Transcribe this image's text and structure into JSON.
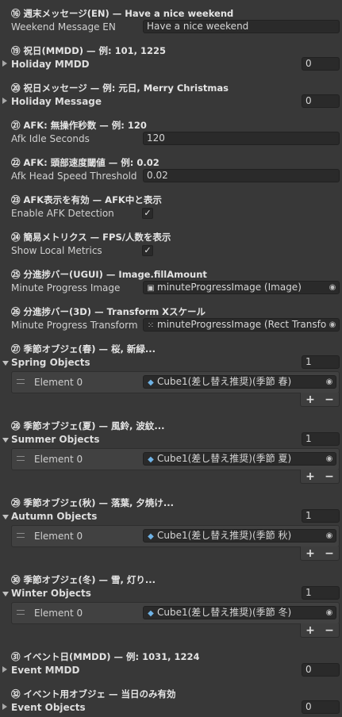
{
  "sections": {
    "s16": {
      "header": "⑯ 週末メッセージ(EN) — Have a nice weekend",
      "label": "Weekend Message EN",
      "value": "Have a nice weekend"
    },
    "s19": {
      "header": "⑲ 祝日(MMDD) — 例: 101, 1225",
      "label": "Holiday MMDD",
      "value": "0"
    },
    "s20": {
      "header": "⑳ 祝日メッセージ — 例: 元日, Merry Christmas",
      "label": "Holiday Message",
      "value": "0"
    },
    "s21": {
      "header": "㉑ AFK: 無操作秒数 — 例: 120",
      "label": "Afk Idle Seconds",
      "value": "120"
    },
    "s22": {
      "header": "㉒ AFK: 頭部速度閾値 — 例: 0.02",
      "label": "Afk Head Speed Threshold",
      "value": "0.02"
    },
    "s23": {
      "header": "㉓ AFK表示を有効 — AFK中と表示",
      "label": "Enable AFK Detection",
      "checked": "✓"
    },
    "s24": {
      "header": "㉔ 簡易メトリクス — FPS/人数を表示",
      "label": "Show Local Metrics",
      "checked": "✓"
    },
    "s25": {
      "header": "㉕ 分進捗バー(UGUI) — Image.fillAmount",
      "label": "Minute Progress Image",
      "value": "minuteProgressImage (Image)"
    },
    "s26": {
      "header": "㉖ 分進捗バー(3D) — Transform Xスケール",
      "label": "Minute Progress Transform",
      "value": "minuteProgressImage (Rect Transform)"
    },
    "s27": {
      "header": "㉗ 季節オブジェ(春) — 桜, 新緑...",
      "label": "Spring Objects",
      "size": "1",
      "element": "Element 0",
      "value": "Cube1(差し替え推奨)(季節 春)"
    },
    "s28": {
      "header": "㉘ 季節オブジェ(夏) — 風鈴, 波紋...",
      "label": "Summer Objects",
      "size": "1",
      "element": "Element 0",
      "value": "Cube1(差し替え推奨)(季節 夏)"
    },
    "s29": {
      "header": "㉙ 季節オブジェ(秋) — 落葉, 夕焼け...",
      "label": "Autumn Objects",
      "size": "1",
      "element": "Element 0",
      "value": "Cube1(差し替え推奨)(季節 秋)"
    },
    "s30": {
      "header": "㉚ 季節オブジェ(冬) — 雪, 灯り...",
      "label": "Winter Objects",
      "size": "1",
      "element": "Element 0",
      "value": "Cube1(差し替え推奨)(季節 冬)"
    },
    "s31": {
      "header": "㉛ イベント日(MMDD) — 例: 1031, 1224",
      "label": "Event MMDD",
      "value": "0"
    },
    "s32": {
      "header": "㉜ イベント用オブジェ — 当日のみ有効",
      "label": "Event Objects",
      "value": "0"
    }
  },
  "buttons": {
    "plus": "+",
    "minus": "−"
  },
  "icons": {
    "image": "image-icon",
    "transform": "rect-transform-icon",
    "cube": "cube-icon",
    "picker": "object-picker-icon"
  }
}
